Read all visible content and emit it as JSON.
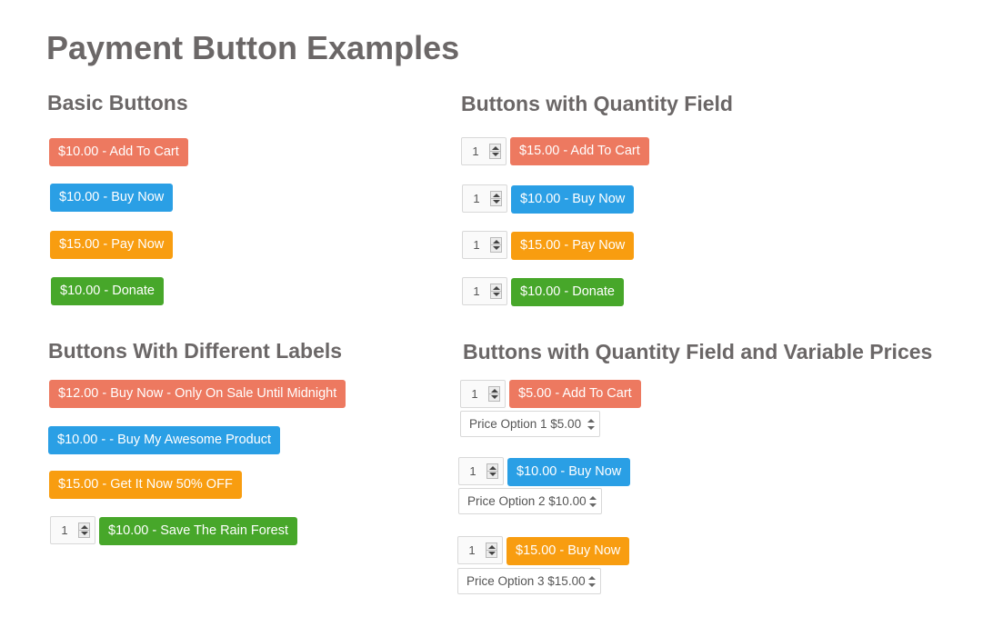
{
  "page": {
    "title": "Payment Button Examples"
  },
  "sections": {
    "basic": {
      "heading": "Basic Buttons",
      "buttons": [
        "$10.00 - Add To Cart",
        "$10.00 - Buy Now",
        "$15.00 - Pay Now",
        "$10.00 - Donate"
      ]
    },
    "quantity": {
      "heading": "Buttons with Quantity Field",
      "rows": [
        {
          "qty": "1",
          "button": "$15.00 - Add To Cart"
        },
        {
          "qty": "1",
          "button": "$10.00 - Buy Now"
        },
        {
          "qty": "1",
          "button": "$15.00 - Pay Now"
        },
        {
          "qty": "1",
          "button": "$10.00 - Donate"
        }
      ]
    },
    "labels": {
      "heading": "Buttons With Different Labels",
      "buttons": [
        "$12.00 - Buy Now - Only On Sale Until Midnight",
        "$10.00 - - Buy My Awesome Product",
        "$15.00 - Get It Now 50% OFF"
      ],
      "qty_row": {
        "qty": "1",
        "button": "$10.00 - Save The Rain Forest"
      }
    },
    "variable": {
      "heading": "Buttons with Quantity Field and Variable Prices",
      "rows": [
        {
          "qty": "1",
          "button": "$5.00 - Add To Cart",
          "price_option": "Price Option 1 $5.00"
        },
        {
          "qty": "1",
          "button": "$10.00 - Buy Now",
          "price_option": "Price Option 2 $10.00"
        },
        {
          "qty": "1",
          "button": "$15.00 - Buy Now",
          "price_option": "Price Option 3 $15.00"
        }
      ]
    }
  },
  "colors": {
    "red": "#ed7960",
    "blue": "#2a9fe5",
    "orange": "#f89d10",
    "green": "#47a72a",
    "heading": "#6b6767"
  }
}
